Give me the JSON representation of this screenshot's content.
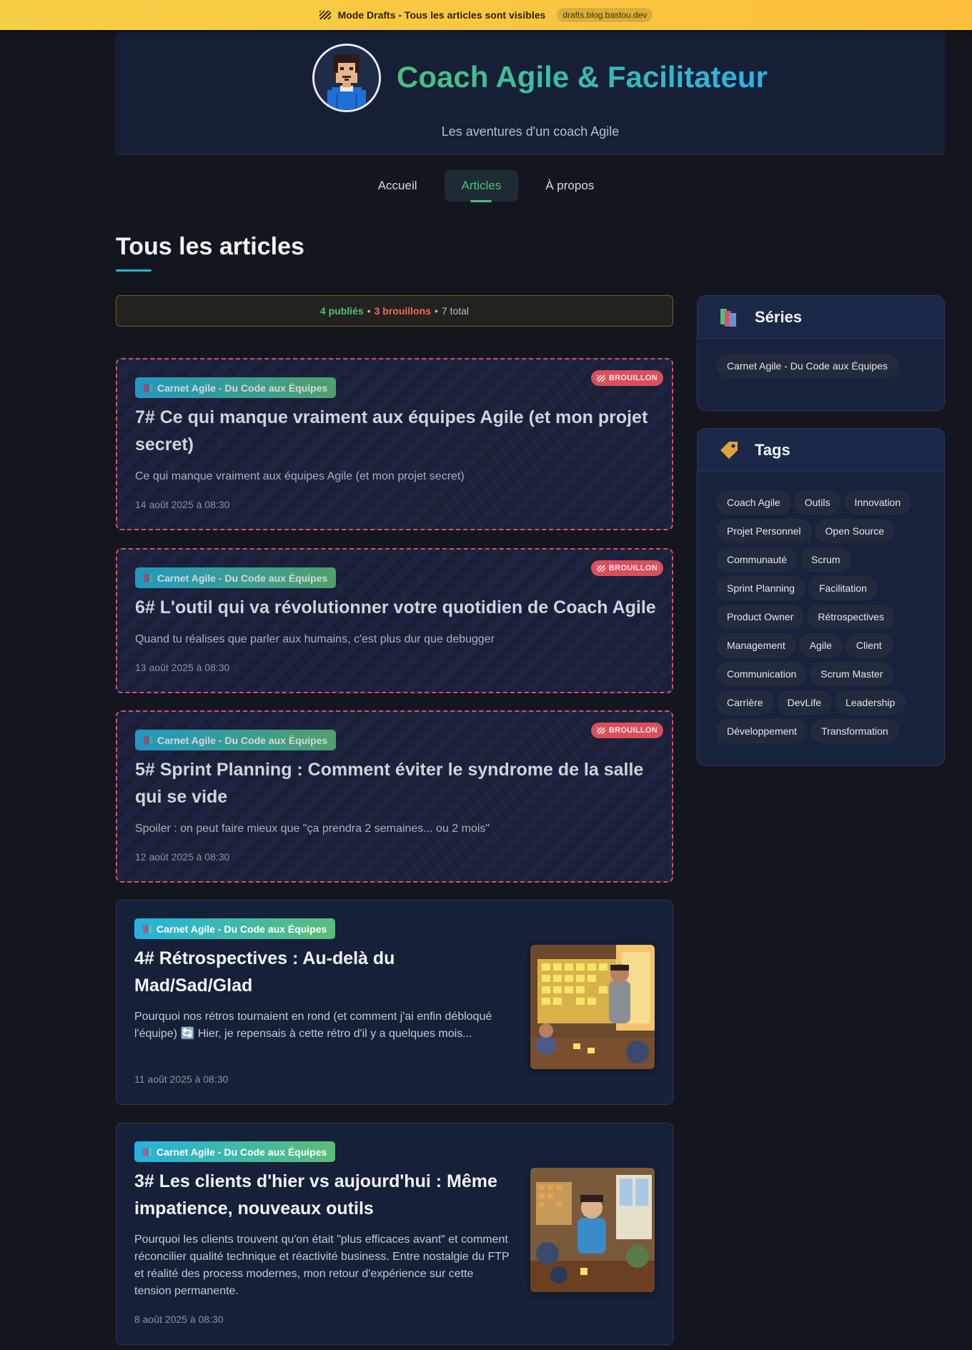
{
  "banner": {
    "text": "Mode Drafts - Tous les articles sont visibles",
    "domain": "drafts.blog.bastou.dev"
  },
  "header": {
    "title": "Coach Agile & Facilitateur",
    "tagline": "Les aventures d'un coach Agile"
  },
  "nav": {
    "items": [
      {
        "label": "Accueil",
        "active": false
      },
      {
        "label": "Articles",
        "active": true
      },
      {
        "label": "À propos",
        "active": false
      }
    ]
  },
  "page": {
    "title": "Tous les articles"
  },
  "stats": {
    "published": "4 publiés",
    "drafts": "3 brouillons",
    "total": "7 total",
    "separator": "•"
  },
  "articles": [
    {
      "series": "Carnet Agile - Du Code aux Équipes",
      "draft_label": "BROUILLON",
      "title": "7# Ce qui manque vraiment aux équipes Agile (et mon projet secret)",
      "excerpt": "Ce qui manque vraiment aux équipes Agile (et mon projet secret)",
      "date": "14 août 2025 à 08:30"
    },
    {
      "series": "Carnet Agile - Du Code aux Équipes",
      "draft_label": "BROUILLON",
      "title": "6# L'outil qui va révolutionner votre quotidien de Coach Agile",
      "excerpt": "Quand tu réalises que parler aux humains, c'est plus dur que debugger",
      "date": "13 août 2025 à 08:30"
    },
    {
      "series": "Carnet Agile - Du Code aux Équipes",
      "draft_label": "BROUILLON",
      "title": "5# Sprint Planning : Comment éviter le syndrome de la salle qui se vide",
      "excerpt": "Spoiler : on peut faire mieux que \"ça prendra 2 semaines... ou 2 mois\"",
      "date": "12 août 2025 à 08:30"
    },
    {
      "series": "Carnet Agile - Du Code aux Équipes",
      "title": "4# Rétrospectives : Au-delà du Mad/Sad/Glad",
      "excerpt_a": "Pourquoi nos rétros tournaient en rond (et comment j'ai enfin débloqué l'équipe)",
      "excerpt_emoji": "🔄",
      "excerpt_b": "Hier, je repensais à cette rétro d'il y a quelques mois...",
      "date": "11 août 2025 à 08:30",
      "thumbnail_icon": "retrospective-illustration"
    },
    {
      "series": "Carnet Agile - Du Code aux Équipes",
      "title": "3# Les clients d'hier vs aujourd'hui : Même impatience, nouveaux outils",
      "excerpt": "Pourquoi les clients trouvent qu'on était \"plus efficaces avant\" et comment réconcilier qualité technique et réactivité business. Entre nostalgie du FTP et réalité des process modernes, mon retour d'expérience sur cette tension permanente.",
      "date": "8 août 2025 à 08:30",
      "thumbnail_icon": "client-meeting-illustration"
    }
  ],
  "sidebar": {
    "series": {
      "title": "Séries",
      "icon": "books-icon",
      "items": [
        "Carnet Agile - Du Code aux Équipes"
      ]
    },
    "tags": {
      "title": "Tags",
      "icon": "tag-icon",
      "items": [
        "Coach Agile",
        "Outils",
        "Innovation",
        "Projet Personnel",
        "Open Source",
        "Communauté",
        "Scrum",
        "Sprint Planning",
        "Facilitation",
        "Product Owner",
        "Rétrospectives",
        "Management",
        "Agile",
        "Client",
        "Communication",
        "Scrum Master",
        "Carrière",
        "DevLife",
        "Leadership",
        "Développement",
        "Transformation"
      ]
    }
  },
  "colors": {
    "accent_green": "#4cc07a",
    "accent_cyan": "#2bb3e6",
    "draft_red": "#d94f5c",
    "banner_yellow": "#f7cf47"
  }
}
